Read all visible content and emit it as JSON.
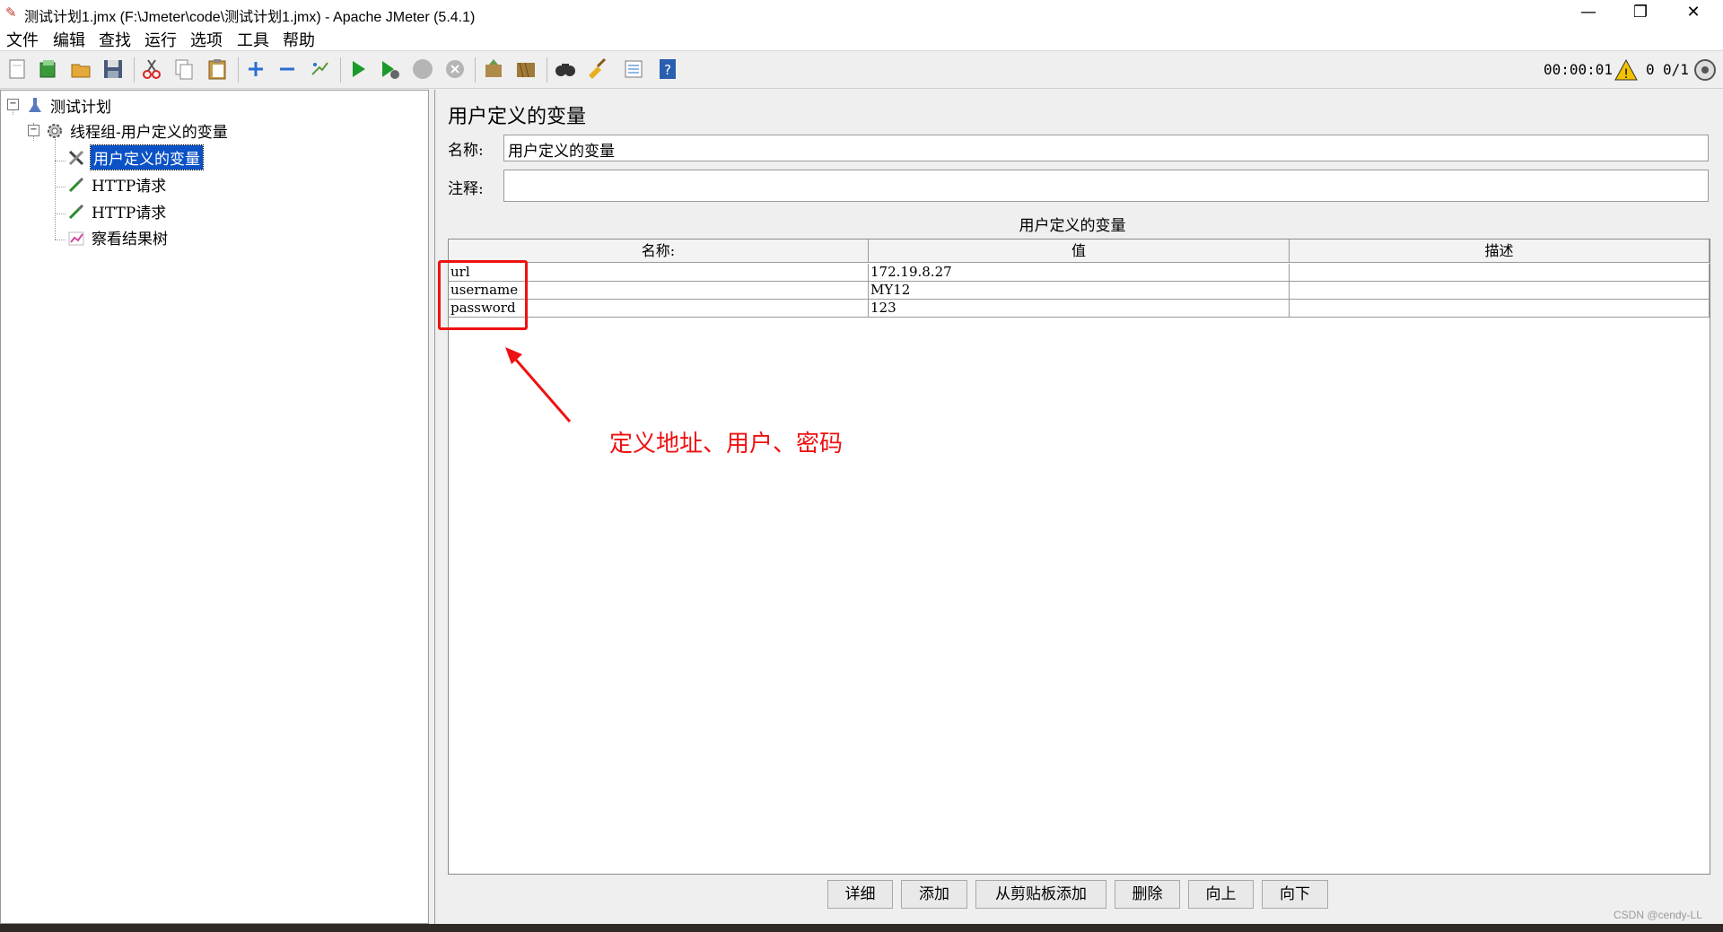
{
  "window": {
    "title": "测试计划1.jmx (F:\\Jmeter\\code\\测试计划1.jmx) - Apache JMeter (5.4.1)",
    "minimize": "—",
    "restore": "❐",
    "close": "✕"
  },
  "menu": [
    "文件",
    "编辑",
    "查找",
    "运行",
    "选项",
    "工具",
    "帮助"
  ],
  "toolbar": {
    "timer": "00:00:01",
    "warning_count": "0",
    "threads": "0/1"
  },
  "tree": {
    "root": "测试计划",
    "thread_group": "线程组-用户定义的变量",
    "children": [
      "用户定义的变量",
      "HTTP请求",
      "HTTP请求",
      "察看结果树"
    ]
  },
  "panel": {
    "title": "用户定义的变量",
    "name_label": "名称:",
    "name_value": "用户定义的变量",
    "comment_label": "注释:",
    "comment_value": "",
    "table_caption": "用户定义的变量",
    "columns": [
      "名称:",
      "值",
      "描述"
    ],
    "rows": [
      {
        "name": "url",
        "value": "172.19.8.27",
        "desc": ""
      },
      {
        "name": "username",
        "value": "MY12",
        "desc": ""
      },
      {
        "name": "password",
        "value": "123",
        "desc": ""
      }
    ],
    "buttons": [
      "详细",
      "添加",
      "从剪贴板添加",
      "删除",
      "向上",
      "向下"
    ]
  },
  "annotation": {
    "text": "定义地址、用户、密码",
    "color": "#ee1111"
  },
  "watermark": "CSDN @cendy-LL"
}
